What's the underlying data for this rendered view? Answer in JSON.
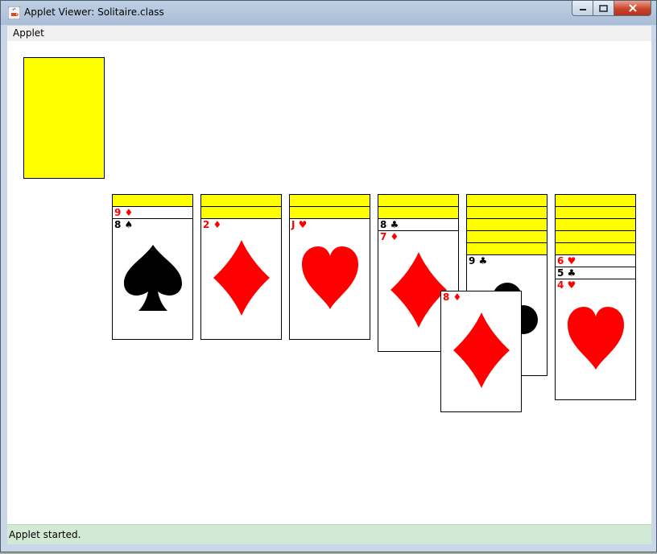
{
  "window": {
    "title": "Applet Viewer: Solitaire.class"
  },
  "menu": {
    "applet": "Applet"
  },
  "status": {
    "text": "Applet started."
  },
  "colors": {
    "card_back": "#ffff00",
    "red_suit": "#ff0000",
    "black_suit": "#000000"
  },
  "game": {
    "stock": {
      "face_down": true
    },
    "piles": [
      {
        "hidden": 1,
        "cards": [
          {
            "rank": "9",
            "suit": "♦",
            "color": "red"
          },
          {
            "rank": "8",
            "suit": "♠",
            "color": "black"
          }
        ]
      },
      {
        "hidden": 2,
        "cards": [
          {
            "rank": "2",
            "suit": "♦",
            "color": "red"
          }
        ]
      },
      {
        "hidden": 2,
        "cards": [
          {
            "rank": "J",
            "suit": "♥",
            "color": "red"
          }
        ]
      },
      {
        "hidden": 2,
        "cards": [
          {
            "rank": "8",
            "suit": "♣",
            "color": "black"
          },
          {
            "rank": "7",
            "suit": "♦",
            "color": "red"
          }
        ]
      },
      {
        "hidden": 5,
        "cards": [
          {
            "rank": "9",
            "suit": "♣",
            "color": "black"
          }
        ]
      },
      {
        "hidden": 5,
        "cards": [
          {
            "rank": "6",
            "suit": "♥",
            "color": "red"
          },
          {
            "rank": "5",
            "suit": "♣",
            "color": "black"
          },
          {
            "rank": "4",
            "suit": "♥",
            "color": "red"
          }
        ]
      }
    ],
    "dragging": {
      "rank": "8",
      "suit": "♦",
      "color": "red"
    }
  }
}
